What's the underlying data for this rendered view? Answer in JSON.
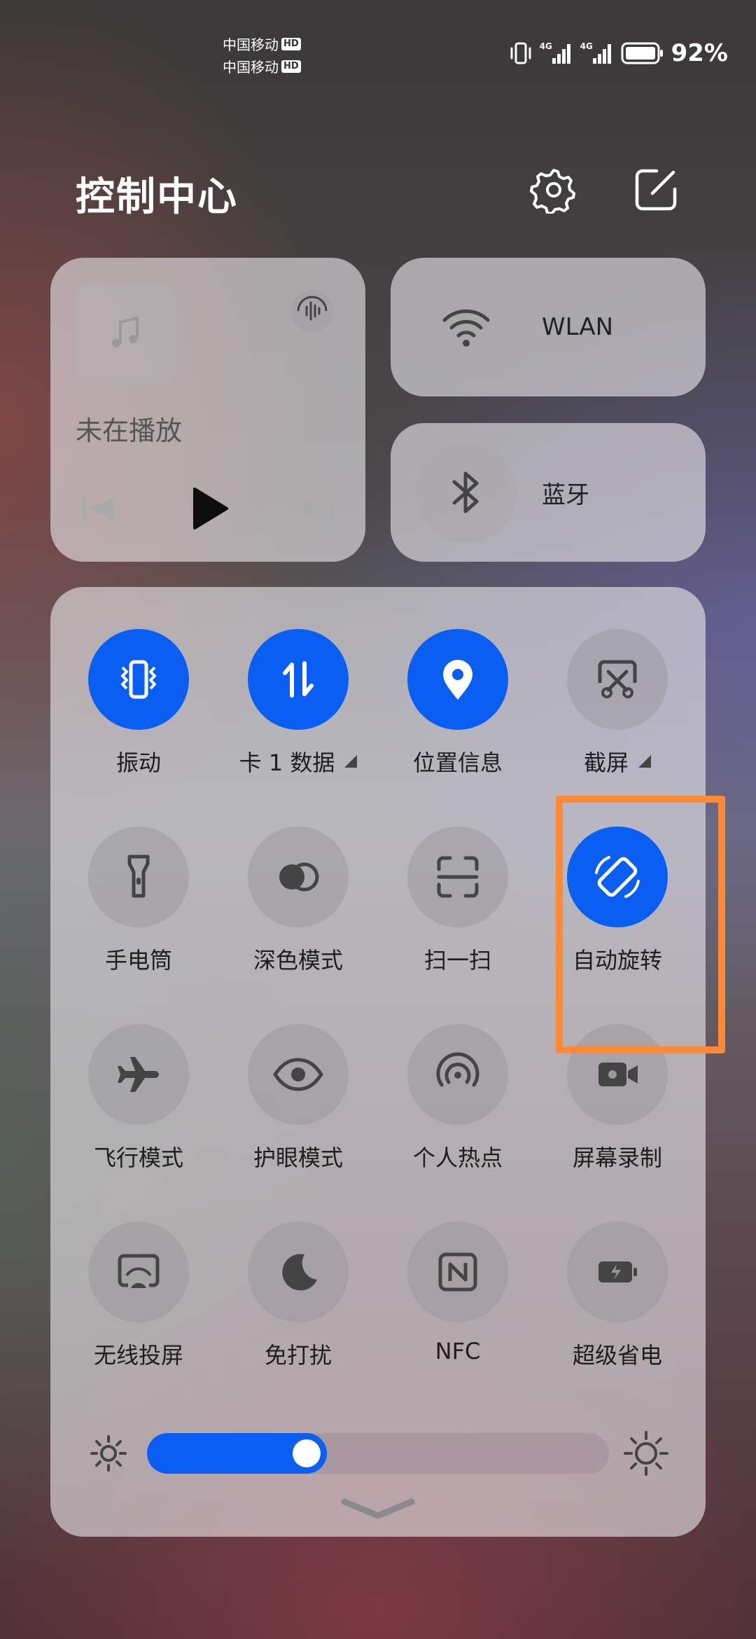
{
  "status_bar": {
    "carrier_1": "中国移动",
    "carrier_2": "中国移动",
    "hd_badge": "HD",
    "battery_pct": "92%",
    "network_1": "4G",
    "network_2": "4G"
  },
  "header": {
    "title": "控制中心",
    "settings_icon": "gear-icon",
    "edit_icon": "edit-icon"
  },
  "media": {
    "title": "未在播放"
  },
  "quick_toggles": [
    {
      "label": "WLAN",
      "icon": "wifi-icon"
    },
    {
      "label": "蓝牙",
      "icon": "bluetooth-icon"
    }
  ],
  "tiles": [
    {
      "label": "振动",
      "icon": "vibrate-icon",
      "on": true
    },
    {
      "label": "卡 1 数据",
      "icon": "mobile-data-icon",
      "on": true,
      "expand": true
    },
    {
      "label": "位置信息",
      "icon": "location-icon",
      "on": true
    },
    {
      "label": "截屏",
      "icon": "screenshot-icon",
      "on": false,
      "expand": true
    },
    {
      "label": "手电筒",
      "icon": "flashlight-icon",
      "on": false
    },
    {
      "label": "深色模式",
      "icon": "dark-mode-icon",
      "on": false
    },
    {
      "label": "扫一扫",
      "icon": "scan-icon",
      "on": false
    },
    {
      "label": "自动旋转",
      "icon": "auto-rotate-icon",
      "on": true
    },
    {
      "label": "飞行模式",
      "icon": "airplane-icon",
      "on": false
    },
    {
      "label": "护眼模式",
      "icon": "eye-icon",
      "on": false
    },
    {
      "label": "个人热点",
      "icon": "hotspot-icon",
      "on": false
    },
    {
      "label": "屏幕录制",
      "icon": "screen-record-icon",
      "on": false
    },
    {
      "label": "无线投屏",
      "icon": "wireless-projection-icon",
      "on": false
    },
    {
      "label": "免打扰",
      "icon": "moon-icon",
      "on": false
    },
    {
      "label": "NFC",
      "icon": "nfc-icon",
      "on": false
    },
    {
      "label": "超级省电",
      "icon": "battery-saver-icon",
      "on": false
    }
  ],
  "brightness": {
    "level": 0.39
  },
  "colors": {
    "accent": "#0a5ff2",
    "highlight": "#ff8a33"
  }
}
